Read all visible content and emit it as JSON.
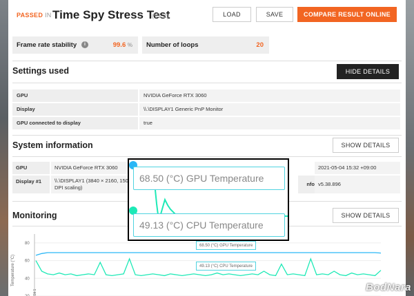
{
  "header": {
    "passed": "PASSED",
    "in": "IN",
    "title": "Time Spy Stress Test",
    "version": "(V1.2)",
    "load": "LOAD",
    "save": "SAVE",
    "compare": "COMPARE RESULT ONLINE"
  },
  "stats": {
    "frame_rate_label": "Frame rate stability",
    "frame_rate_value": "99.6",
    "frame_rate_unit": "%",
    "loops_label": "Number of loops",
    "loops_value": "20"
  },
  "settings": {
    "title": "Settings used",
    "hide_details": "HIDE DETAILS",
    "rows": [
      {
        "k": "GPU",
        "v": "NVIDIA GeForce RTX 3060"
      },
      {
        "k": "Display",
        "v": "\\\\.\\DISPLAY1 Generic PnP Monitor"
      },
      {
        "k": "GPU connected to display",
        "v": "true"
      }
    ]
  },
  "sysinfo": {
    "title": "System information",
    "show_details": "SHOW DETAILS",
    "gpu_k": "GPU",
    "gpu_v": "NVIDIA GeForce RTX 3060",
    "display_k": "Display #1",
    "display_v1": "\\\\.\\DISPLAY1 (3840 × 2160, 150%",
    "display_v2": "DPI scaling)",
    "time_v": "2021-05-04 15:32 +09:00",
    "info_k": "nfo",
    "info_v": "v5.38.896"
  },
  "monitoring": {
    "title": "Monitoring",
    "show_details": "SHOW DETAILS",
    "ylabel": "Temperature (°C)",
    "xtick0": "Stt 1",
    "gpu_label": "68.50 (°C) GPU Temperature",
    "cpu_label": "49.13 (°C) CPU Temperature"
  },
  "overlay": {
    "gpu": "68.50 (°C) GPU Temperature",
    "cpu": "49.13 (°C) CPU Temperature"
  },
  "watermark": "BodNara",
  "chart_data": {
    "type": "line",
    "ylabel": "Temperature (°C)",
    "yticks": [
      "80",
      "60",
      "40",
      "20"
    ],
    "ylim": [
      20,
      90
    ],
    "series": [
      {
        "name": "GPU Temperature",
        "color": "#29b6f6",
        "values": [
          66,
          68,
          69,
          69,
          69,
          69,
          69,
          69,
          69,
          69,
          69,
          69,
          69,
          69,
          69,
          69,
          69,
          69,
          69,
          69,
          69,
          69,
          69,
          69,
          69,
          69,
          69,
          69,
          69,
          69,
          69,
          69,
          69,
          69,
          69,
          69,
          69,
          69,
          69,
          69,
          69,
          69,
          69,
          69,
          69,
          69,
          69,
          69,
          69,
          69,
          69,
          69,
          69,
          69,
          69,
          69,
          69,
          69,
          69,
          68.5
        ]
      },
      {
        "name": "CPU Temperature",
        "color": "#1de9b6",
        "values": [
          60,
          48,
          45,
          44,
          46,
          44,
          45,
          43,
          44,
          45,
          44,
          58,
          44,
          43,
          44,
          45,
          62,
          44,
          43,
          44,
          45,
          44,
          43,
          45,
          44,
          43,
          44,
          45,
          44,
          43,
          44,
          46,
          44,
          45,
          44,
          43,
          44,
          45,
          44,
          48,
          44,
          43,
          56,
          44,
          45,
          44,
          43,
          62,
          44,
          45,
          44,
          48,
          44,
          43,
          46,
          44,
          45,
          44,
          43,
          49
        ]
      }
    ]
  },
  "colors": {
    "accent": "#f26522",
    "gpu_line": "#29b6f6",
    "cpu_line": "#1de9b6"
  }
}
